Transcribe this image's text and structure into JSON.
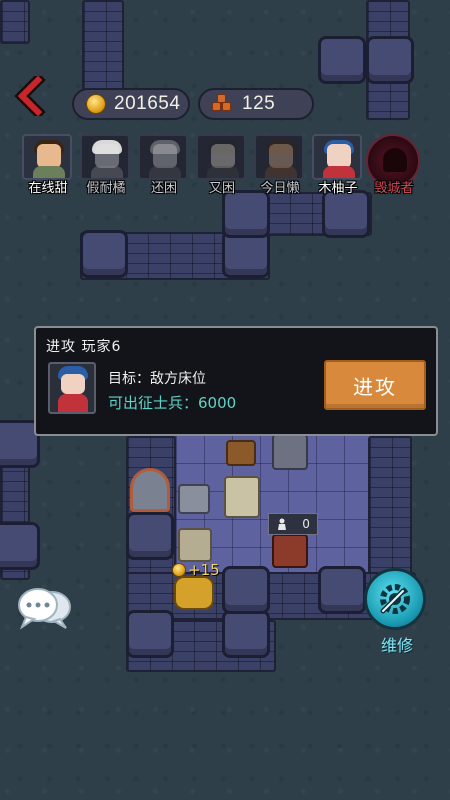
{
  "header": {
    "gold": "201654",
    "ore": "125"
  },
  "players": [
    {
      "name": "在线甜",
      "dim": false
    },
    {
      "name": "假耐橘",
      "dim": true
    },
    {
      "name": "还困",
      "dim": true
    },
    {
      "name": "又困",
      "dim": true
    },
    {
      "name": "今日懒",
      "dim": true
    },
    {
      "name": "木柚子",
      "dim": false
    },
    {
      "name": "毁城者",
      "dim": false
    }
  ],
  "attack_panel": {
    "title": "进攻 玩家6",
    "target": "目标：敌方床位",
    "troops": "可出征士兵：6000",
    "button": "进攻"
  },
  "map": {
    "gold_bonus": "+15",
    "bed_count": "0"
  },
  "repair": {
    "label": "维修"
  },
  "colors": {
    "accent_orange": "#d9893b",
    "troops_teal": "#5fd4c7",
    "repair_cyan": "#5be0f0",
    "back_red": "#c8262a",
    "gold": "#e3a31b"
  },
  "icons": {
    "back": "chevron-left-icon",
    "gold": "coin-icon",
    "ore": "ore-icon",
    "chat": "chat-bubble-icon",
    "repair": "wrench-gear-icon"
  }
}
